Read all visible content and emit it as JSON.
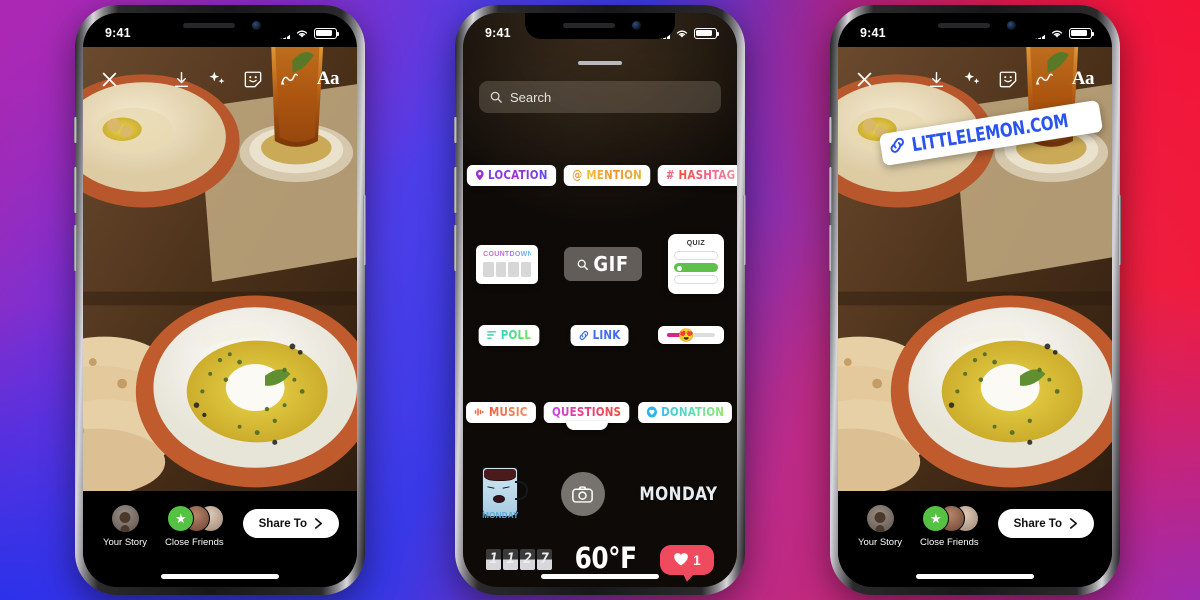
{
  "background": {
    "colors": [
      "#ac28b4",
      "#2832eb",
      "#f5123 7",
      "#962dbe"
    ]
  },
  "status_bar": {
    "time": "9:41",
    "signal": "cellular-bars",
    "wifi": "wifi-icon",
    "battery": "battery-icon"
  },
  "toolbar": {
    "close": "close-icon",
    "save": "download-icon",
    "effects": "sparkles-icon",
    "stickers": "sticker-smiley-icon",
    "draw": "draw-squiggle-icon",
    "text": "Aa"
  },
  "bottom_bar": {
    "your_story_label": "Your Story",
    "close_friends_label": "Close Friends",
    "share_label": "Share To",
    "share_chevron": "chevron-right-icon"
  },
  "link_sticker": {
    "url": "LITTLELEMON.COM",
    "icon": "chain-link-icon"
  },
  "tray": {
    "search_placeholder": "Search",
    "search_icon": "search-icon",
    "grabber": "drag-handle",
    "rows": [
      {
        "items": [
          {
            "name": "location",
            "label": "LOCATION",
            "icon": "location-pin-icon"
          },
          {
            "name": "mention",
            "label": "MENTION",
            "icon": "at-sign-icon"
          },
          {
            "name": "hashtag",
            "label": "HASHTAG",
            "icon": "hash-icon"
          }
        ]
      },
      {
        "items": [
          {
            "name": "countdown",
            "label": "COUNTDOWN"
          },
          {
            "name": "gif",
            "label": "GIF",
            "icon": "search-icon"
          },
          {
            "name": "quiz",
            "label": "QUIZ"
          }
        ]
      },
      {
        "items": [
          {
            "name": "poll",
            "label": "POLL",
            "icon": "poll-bars-icon"
          },
          {
            "name": "link",
            "label": "LINK",
            "icon": "chain-link-icon"
          },
          {
            "name": "emoji-slider",
            "label": "",
            "emoji": "😍"
          }
        ]
      },
      {
        "items": [
          {
            "name": "music",
            "label": "MUSIC",
            "icon": "music-waveform-icon"
          },
          {
            "name": "questions",
            "label": "QUESTIONS"
          },
          {
            "name": "donation",
            "label": "DONATION",
            "icon": "heart-circle-icon"
          }
        ]
      },
      {
        "items": [
          {
            "name": "monday-mug",
            "label": "MONDAY"
          },
          {
            "name": "camera",
            "label": "",
            "icon": "camera-icon"
          },
          {
            "name": "monday-text",
            "label": "MONDAY"
          }
        ]
      },
      {
        "items": [
          {
            "name": "clock",
            "label": "1127",
            "digits": [
              "1",
              "1",
              "2",
              "7"
            ]
          },
          {
            "name": "temperature",
            "label": "60°F"
          },
          {
            "name": "like-counter",
            "label": "1",
            "icon": "heart-icon"
          }
        ]
      }
    ]
  }
}
